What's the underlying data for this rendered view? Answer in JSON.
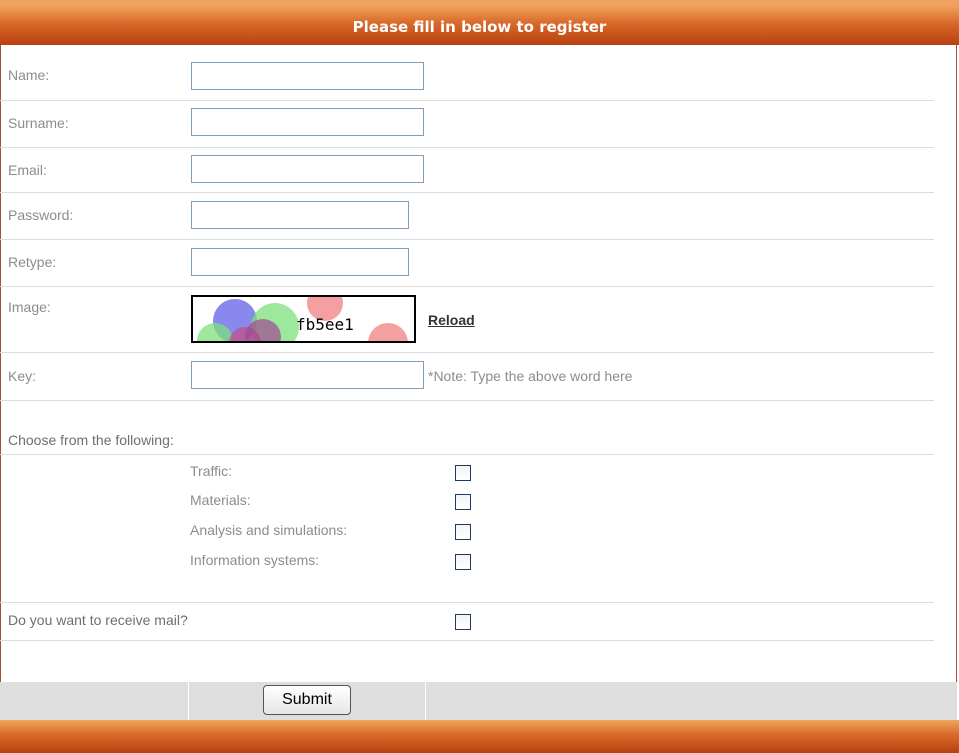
{
  "header": {
    "title": "Please fill in below to register"
  },
  "fields": {
    "name": {
      "label": "Name:",
      "value": ""
    },
    "surname": {
      "label": "Surname:",
      "value": ""
    },
    "email": {
      "label": "Email:",
      "value": ""
    },
    "password": {
      "label": "Password:",
      "value": ""
    },
    "retype": {
      "label": "Retype:",
      "value": ""
    },
    "image": {
      "label": "Image:",
      "captcha_text": "fb5ee1",
      "reload_label": "Reload"
    },
    "key": {
      "label": "Key:",
      "value": "",
      "note": "*Note: Type the above word here"
    }
  },
  "choices": {
    "heading": "Choose from the following:",
    "options": [
      {
        "label": "Traffic:",
        "checked": false
      },
      {
        "label": "Materials:",
        "checked": false
      },
      {
        "label": "Analysis and simulations:",
        "checked": false
      },
      {
        "label": "Information systems:",
        "checked": false
      }
    ]
  },
  "mail": {
    "label": "Do you want to receive mail?",
    "checked": false
  },
  "footer": {
    "submit_label": "Submit"
  },
  "colors": {
    "header_top": "#f0a55a",
    "header_bottom": "#b8410f",
    "label_gray": "#8c8c8c",
    "input_border": "#7f9db9"
  }
}
